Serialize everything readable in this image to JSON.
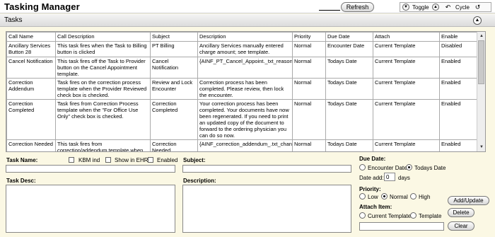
{
  "app": {
    "title": "Tasking Manager"
  },
  "toolbar": {
    "refresh_label": "Refresh",
    "toggle_label": "Toggle",
    "cycle_label": "Cycle"
  },
  "section": {
    "title": "Tasks"
  },
  "grid": {
    "columns": [
      "Call Name",
      "Call Description",
      "Subject",
      "Description",
      "Priority",
      "Due Date",
      "Attach",
      "Enable"
    ],
    "rows": [
      [
        "Ancillary Services Button 28",
        "This task fires when the Task to Billing button is clicked",
        "PT Billing",
        "Ancillary Services manually entered charge amount; see template.",
        "Normal",
        "Encounter Date",
        "Current Template",
        "Disabled"
      ],
      [
        "Cancel Notification",
        "This task fires off the Task to Provider button on the Cancel Appointment template.",
        "Cancel Notification",
        "{AINF_PT_Cancel_Appoint._txt_reason}",
        "Normal",
        "Todays Date",
        "Current Template",
        "Enabled"
      ],
      [
        "Correction Addendum",
        "Task fires on the correction process template when the Provider Reviewed check box is checked.",
        "Review and Lock Encounter",
        "Correction process has been completed.  Please review, then lock the encounter.",
        "Normal",
        "Todays Date",
        "Current Template",
        "Enabled"
      ],
      [
        "Correction Completed",
        "Task fires from Correction Process template when the \"For Office Use Only\" check box is checked.",
        "Correction Completed",
        "Your correction process has been completed.  Your documents have now been regenerated.  If you need to print an updated copy of the document to forward to the ordering physician you can do so now.",
        "Normal",
        "Todays Date",
        "Current Template",
        "Enabled"
      ],
      [
        "Correction Needed",
        "This task fires from correction/addendum template when \"Add to grid button is",
        "Correction Needed",
        "{AINF_correction_addendum_.txt_chang",
        "Normal",
        "Todays Date",
        "Current Template",
        "Enabled"
      ]
    ]
  },
  "form": {
    "task_name_label": "Task Name:",
    "task_name_value": "",
    "kbm_label": "KBM ind",
    "show_ehr_label": "Show in EHR",
    "enabled_label": "Enabled",
    "subject_label": "Subject:",
    "subject_value": "",
    "task_desc_label": "Task Desc:",
    "task_desc_value": "",
    "description_label": "Description:",
    "description_value": "",
    "due_date_label": "Due Date:",
    "due_encounter_label": "Encounter Date",
    "due_todays_label": "Todays Date",
    "due_selected": "Todays Date",
    "date_add_label": "Date add:",
    "date_add_value": "0",
    "days_label": "days",
    "priority_label": "Priority:",
    "priority_low": "Low",
    "priority_normal": "Normal",
    "priority_high": "High",
    "priority_selected": "Normal",
    "attach_label": "Attach Item:",
    "attach_current": "Current Template",
    "attach_template": "Template",
    "attach_value": "",
    "add_update_label": "Add/Update",
    "delete_label": "Delete",
    "clear_label": "Clear"
  }
}
